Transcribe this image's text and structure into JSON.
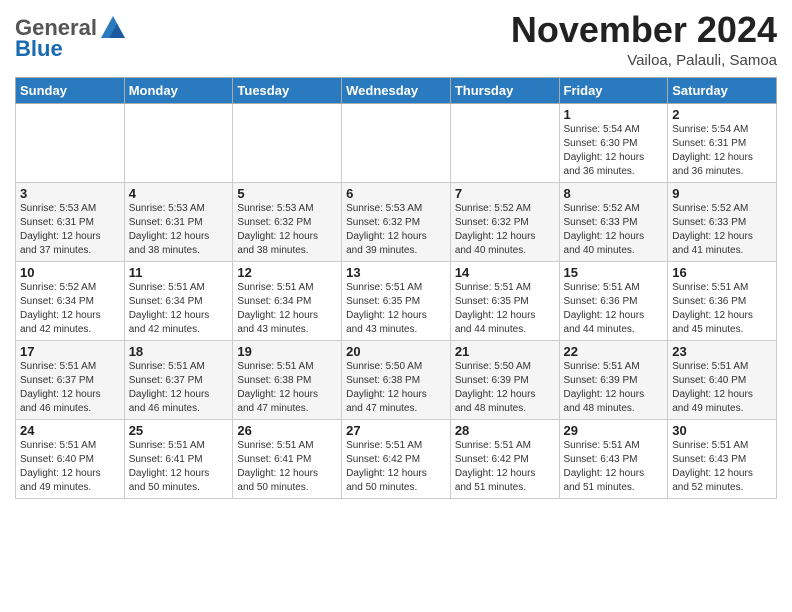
{
  "header": {
    "logo_general": "General",
    "logo_blue": "Blue",
    "month_title": "November 2024",
    "location": "Vailoa, Palauli, Samoa"
  },
  "weekdays": [
    "Sunday",
    "Monday",
    "Tuesday",
    "Wednesday",
    "Thursday",
    "Friday",
    "Saturday"
  ],
  "weeks": [
    [
      {
        "day": "",
        "info": ""
      },
      {
        "day": "",
        "info": ""
      },
      {
        "day": "",
        "info": ""
      },
      {
        "day": "",
        "info": ""
      },
      {
        "day": "",
        "info": ""
      },
      {
        "day": "1",
        "info": "Sunrise: 5:54 AM\nSunset: 6:30 PM\nDaylight: 12 hours and 36 minutes."
      },
      {
        "day": "2",
        "info": "Sunrise: 5:54 AM\nSunset: 6:31 PM\nDaylight: 12 hours and 36 minutes."
      }
    ],
    [
      {
        "day": "3",
        "info": "Sunrise: 5:53 AM\nSunset: 6:31 PM\nDaylight: 12 hours and 37 minutes."
      },
      {
        "day": "4",
        "info": "Sunrise: 5:53 AM\nSunset: 6:31 PM\nDaylight: 12 hours and 38 minutes."
      },
      {
        "day": "5",
        "info": "Sunrise: 5:53 AM\nSunset: 6:32 PM\nDaylight: 12 hours and 38 minutes."
      },
      {
        "day": "6",
        "info": "Sunrise: 5:53 AM\nSunset: 6:32 PM\nDaylight: 12 hours and 39 minutes."
      },
      {
        "day": "7",
        "info": "Sunrise: 5:52 AM\nSunset: 6:32 PM\nDaylight: 12 hours and 40 minutes."
      },
      {
        "day": "8",
        "info": "Sunrise: 5:52 AM\nSunset: 6:33 PM\nDaylight: 12 hours and 40 minutes."
      },
      {
        "day": "9",
        "info": "Sunrise: 5:52 AM\nSunset: 6:33 PM\nDaylight: 12 hours and 41 minutes."
      }
    ],
    [
      {
        "day": "10",
        "info": "Sunrise: 5:52 AM\nSunset: 6:34 PM\nDaylight: 12 hours and 42 minutes."
      },
      {
        "day": "11",
        "info": "Sunrise: 5:51 AM\nSunset: 6:34 PM\nDaylight: 12 hours and 42 minutes."
      },
      {
        "day": "12",
        "info": "Sunrise: 5:51 AM\nSunset: 6:34 PM\nDaylight: 12 hours and 43 minutes."
      },
      {
        "day": "13",
        "info": "Sunrise: 5:51 AM\nSunset: 6:35 PM\nDaylight: 12 hours and 43 minutes."
      },
      {
        "day": "14",
        "info": "Sunrise: 5:51 AM\nSunset: 6:35 PM\nDaylight: 12 hours and 44 minutes."
      },
      {
        "day": "15",
        "info": "Sunrise: 5:51 AM\nSunset: 6:36 PM\nDaylight: 12 hours and 44 minutes."
      },
      {
        "day": "16",
        "info": "Sunrise: 5:51 AM\nSunset: 6:36 PM\nDaylight: 12 hours and 45 minutes."
      }
    ],
    [
      {
        "day": "17",
        "info": "Sunrise: 5:51 AM\nSunset: 6:37 PM\nDaylight: 12 hours and 46 minutes."
      },
      {
        "day": "18",
        "info": "Sunrise: 5:51 AM\nSunset: 6:37 PM\nDaylight: 12 hours and 46 minutes."
      },
      {
        "day": "19",
        "info": "Sunrise: 5:51 AM\nSunset: 6:38 PM\nDaylight: 12 hours and 47 minutes."
      },
      {
        "day": "20",
        "info": "Sunrise: 5:50 AM\nSunset: 6:38 PM\nDaylight: 12 hours and 47 minutes."
      },
      {
        "day": "21",
        "info": "Sunrise: 5:50 AM\nSunset: 6:39 PM\nDaylight: 12 hours and 48 minutes."
      },
      {
        "day": "22",
        "info": "Sunrise: 5:51 AM\nSunset: 6:39 PM\nDaylight: 12 hours and 48 minutes."
      },
      {
        "day": "23",
        "info": "Sunrise: 5:51 AM\nSunset: 6:40 PM\nDaylight: 12 hours and 49 minutes."
      }
    ],
    [
      {
        "day": "24",
        "info": "Sunrise: 5:51 AM\nSunset: 6:40 PM\nDaylight: 12 hours and 49 minutes."
      },
      {
        "day": "25",
        "info": "Sunrise: 5:51 AM\nSunset: 6:41 PM\nDaylight: 12 hours and 50 minutes."
      },
      {
        "day": "26",
        "info": "Sunrise: 5:51 AM\nSunset: 6:41 PM\nDaylight: 12 hours and 50 minutes."
      },
      {
        "day": "27",
        "info": "Sunrise: 5:51 AM\nSunset: 6:42 PM\nDaylight: 12 hours and 50 minutes."
      },
      {
        "day": "28",
        "info": "Sunrise: 5:51 AM\nSunset: 6:42 PM\nDaylight: 12 hours and 51 minutes."
      },
      {
        "day": "29",
        "info": "Sunrise: 5:51 AM\nSunset: 6:43 PM\nDaylight: 12 hours and 51 minutes."
      },
      {
        "day": "30",
        "info": "Sunrise: 5:51 AM\nSunset: 6:43 PM\nDaylight: 12 hours and 52 minutes."
      }
    ]
  ]
}
